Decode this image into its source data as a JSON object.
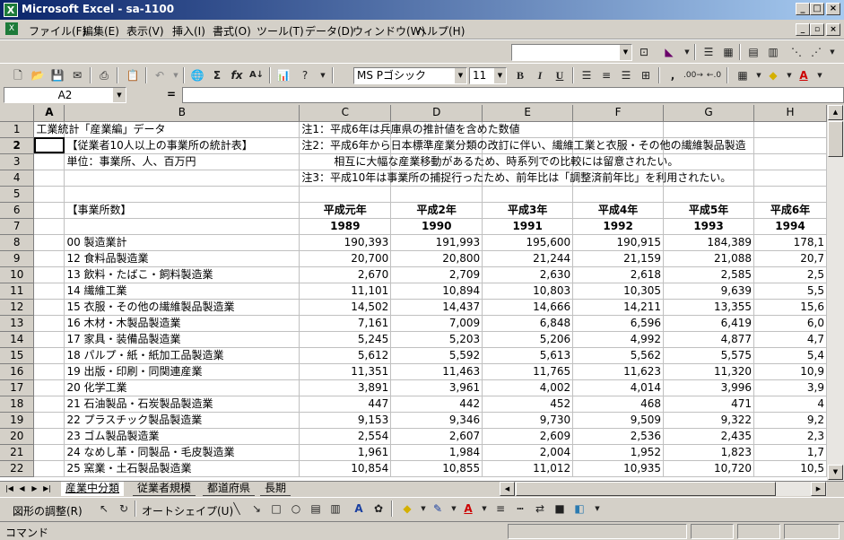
{
  "window": {
    "title": "Microsoft Excel - sa-1100",
    "app_icon": "X"
  },
  "menu": {
    "items": [
      "ファイル(F)",
      "編集(E)",
      "表示(V)",
      "挿入(I)",
      "書式(O)",
      "ツール(T)",
      "データ(D)",
      "ウィンドウ(W)",
      "ヘルプ(H)"
    ]
  },
  "toolbar": {
    "font_name": "MS Pゴシック",
    "font_size": "11"
  },
  "formula": {
    "cell_ref": "A2",
    "equals": "=",
    "value": ""
  },
  "columns": [
    "A",
    "B",
    "C",
    "D",
    "E",
    "F",
    "G",
    "H"
  ],
  "rows": [
    {
      "n": "1",
      "a": "工業統計「産業編」データ",
      "b": "",
      "c": "注1：平成6年は兵庫県の推計値を含めた数値",
      "d": "",
      "e": "",
      "f": "",
      "g": "",
      "h": ""
    },
    {
      "n": "2",
      "a": "",
      "b": "【従業者10人以上の事業所の統計表】",
      "c": "注2：平成6年から日本標準産業分類の改訂に伴い、繊維工業と衣服・その他の繊維製品製造",
      "d": "",
      "e": "",
      "f": "",
      "g": "",
      "h": ""
    },
    {
      "n": "3",
      "a": "",
      "b": "単位：事業所、人、百万円",
      "c": "　　　相互に大幅な産業移動があるため、時系列での比較には留意されたい。",
      "d": "",
      "e": "",
      "f": "",
      "g": "",
      "h": ""
    },
    {
      "n": "4",
      "a": "",
      "b": "",
      "c": "注3：平成10年は事業所の捕捉行ったため、前年比は「調整済前年比」を利用されたい。",
      "d": "",
      "e": "",
      "f": "",
      "g": "",
      "h": ""
    },
    {
      "n": "5",
      "a": "",
      "b": "",
      "c": "",
      "d": "",
      "e": "",
      "f": "",
      "g": "",
      "h": ""
    },
    {
      "n": "6",
      "a": "",
      "b": "【事業所数】",
      "c": "平成元年",
      "d": "平成2年",
      "e": "平成3年",
      "f": "平成4年",
      "g": "平成5年",
      "h": "平成6年"
    },
    {
      "n": "7",
      "a": "",
      "b": "",
      "c": "1989",
      "d": "1990",
      "e": "1991",
      "f": "1992",
      "g": "1993",
      "h": "1994"
    },
    {
      "n": "8",
      "a": "",
      "b": "00 製造業計",
      "c": "190,393",
      "d": "191,993",
      "e": "195,600",
      "f": "190,915",
      "g": "184,389",
      "h": "178,1"
    },
    {
      "n": "9",
      "a": "",
      "b": "12 食料品製造業",
      "c": "20,700",
      "d": "20,800",
      "e": "21,244",
      "f": "21,159",
      "g": "21,088",
      "h": "20,7"
    },
    {
      "n": "10",
      "a": "",
      "b": "13 飲料・たばこ・飼料製造業",
      "c": "2,670",
      "d": "2,709",
      "e": "2,630",
      "f": "2,618",
      "g": "2,585",
      "h": "2,5"
    },
    {
      "n": "11",
      "a": "",
      "b": "14 繊維工業",
      "c": "11,101",
      "d": "10,894",
      "e": "10,803",
      "f": "10,305",
      "g": "9,639",
      "h": "5,5"
    },
    {
      "n": "12",
      "a": "",
      "b": "15 衣服・その他の繊維製品製造業",
      "c": "14,502",
      "d": "14,437",
      "e": "14,666",
      "f": "14,211",
      "g": "13,355",
      "h": "15,6"
    },
    {
      "n": "13",
      "a": "",
      "b": "16 木材・木製品製造業",
      "c": "7,161",
      "d": "7,009",
      "e": "6,848",
      "f": "6,596",
      "g": "6,419",
      "h": "6,0"
    },
    {
      "n": "14",
      "a": "",
      "b": "17 家具・装備品製造業",
      "c": "5,245",
      "d": "5,203",
      "e": "5,206",
      "f": "4,992",
      "g": "4,877",
      "h": "4,7"
    },
    {
      "n": "15",
      "a": "",
      "b": "18 パルプ・紙・紙加工品製造業",
      "c": "5,612",
      "d": "5,592",
      "e": "5,613",
      "f": "5,562",
      "g": "5,575",
      "h": "5,4"
    },
    {
      "n": "16",
      "a": "",
      "b": "19 出版・印刷・同関連産業",
      "c": "11,351",
      "d": "11,463",
      "e": "11,765",
      "f": "11,623",
      "g": "11,320",
      "h": "10,9"
    },
    {
      "n": "17",
      "a": "",
      "b": "20 化学工業",
      "c": "3,891",
      "d": "3,961",
      "e": "4,002",
      "f": "4,014",
      "g": "3,996",
      "h": "3,9"
    },
    {
      "n": "18",
      "a": "",
      "b": "21 石油製品・石炭製品製造業",
      "c": "447",
      "d": "442",
      "e": "452",
      "f": "468",
      "g": "471",
      "h": "4"
    },
    {
      "n": "19",
      "a": "",
      "b": "22 プラスチック製品製造業",
      "c": "9,153",
      "d": "9,346",
      "e": "9,730",
      "f": "9,509",
      "g": "9,322",
      "h": "9,2"
    },
    {
      "n": "20",
      "a": "",
      "b": "23 ゴム製品製造業",
      "c": "2,554",
      "d": "2,607",
      "e": "2,609",
      "f": "2,536",
      "g": "2,435",
      "h": "2,3"
    },
    {
      "n": "21",
      "a": "",
      "b": "24 なめし革・同製品・毛皮製造業",
      "c": "1,961",
      "d": "1,984",
      "e": "2,004",
      "f": "1,952",
      "g": "1,823",
      "h": "1,7"
    },
    {
      "n": "22",
      "a": "",
      "b": "25 窯業・土石製品製造業",
      "c": "10,854",
      "d": "10,855",
      "e": "11,012",
      "f": "10,935",
      "g": "10,720",
      "h": "10,5"
    }
  ],
  "sheet_tabs": [
    "産業中分類",
    "従業者規模",
    "都道府県",
    "長期"
  ],
  "draw": {
    "adjust": "図形の調整(R)",
    "autoshape": "オートシェイプ(U)"
  },
  "status": {
    "mode": "コマンド"
  },
  "colors": {
    "title_start": "#0a246a",
    "title_end": "#a6caf0",
    "face": "#d4d0c8",
    "grid": "#c0c0c0"
  }
}
